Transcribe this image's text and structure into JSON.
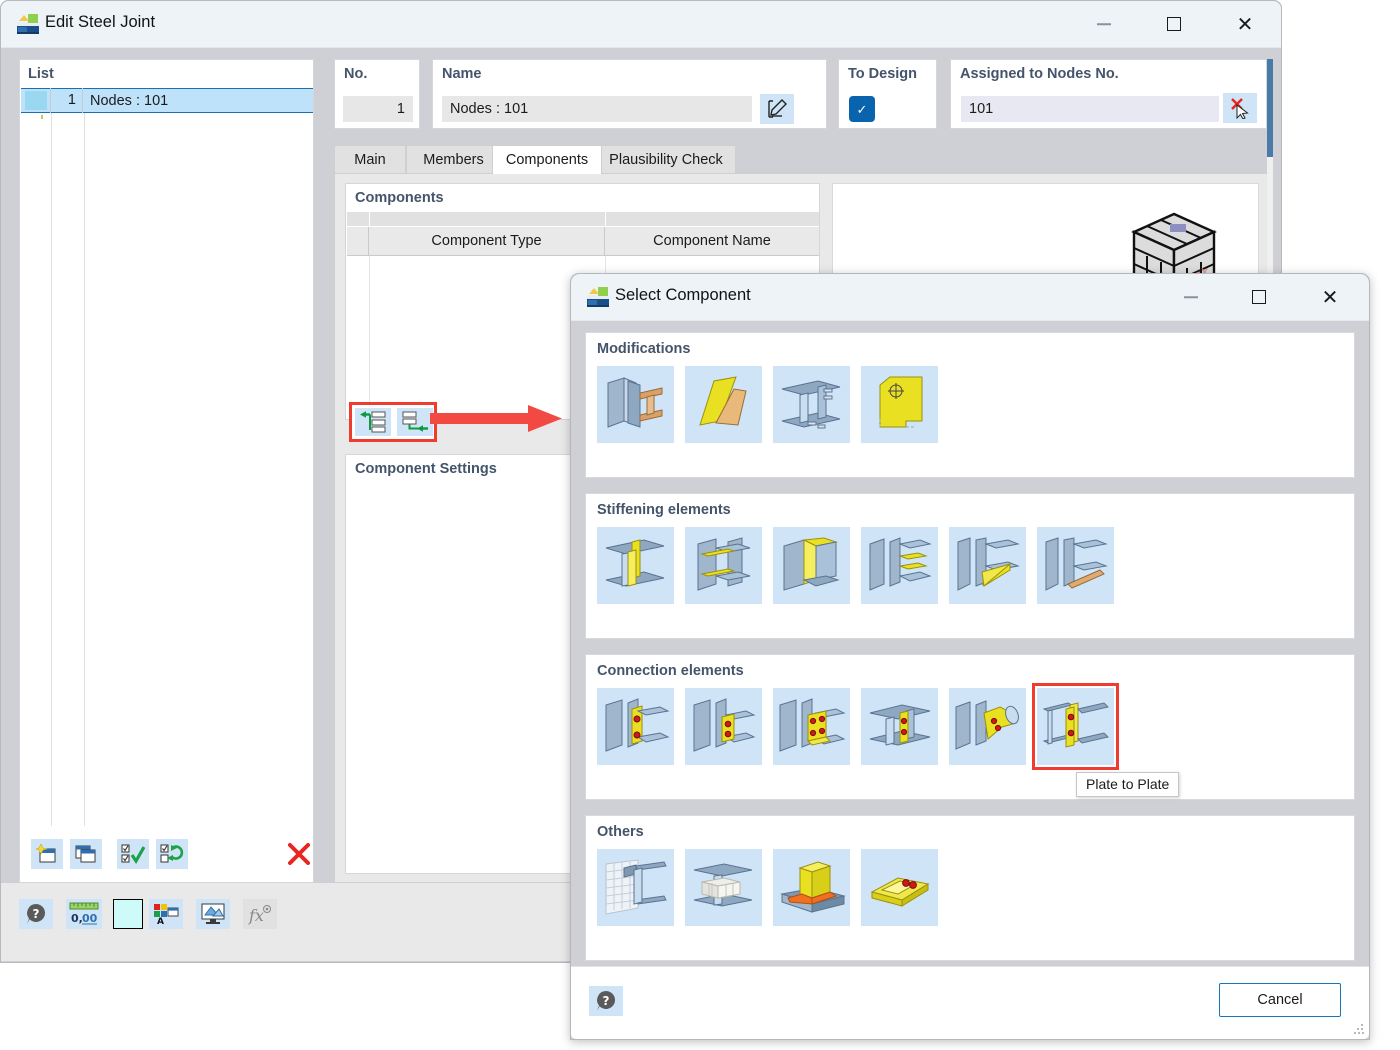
{
  "main_window": {
    "title": "Edit Steel Joint",
    "icon": "steel-joint-app-icon",
    "controls": {
      "minimize": "minimize-icon",
      "maximize": "maximize-icon",
      "close": "close-icon"
    }
  },
  "list_panel": {
    "header": "List",
    "rows": [
      {
        "color": "#9ad8f2",
        "no": "1",
        "name": "Nodes : 101"
      }
    ],
    "toolbar": [
      {
        "name": "new-item-button",
        "icon": "new-window-icon"
      },
      {
        "name": "copy-item-button",
        "icon": "copy-window-icon"
      },
      {
        "name": "check-all-button",
        "icon": "checklist-check-icon"
      },
      {
        "name": "toggle-selection-button",
        "icon": "checklist-refresh-icon"
      },
      {
        "name": "delete-item-button",
        "icon": "red-x-icon"
      }
    ]
  },
  "fields": {
    "no": {
      "label": "No.",
      "value": "1"
    },
    "name": {
      "label": "Name",
      "value": "Nodes : 101",
      "edit_button": "edit-pencil-icon"
    },
    "to_design": {
      "label": "To Design",
      "checked": true
    },
    "assigned_nodes": {
      "label": "Assigned to Nodes No.",
      "value": "101",
      "pick_button": "pick-node-cursor-icon"
    }
  },
  "tabs": [
    {
      "label": "Main",
      "active": false
    },
    {
      "label": "Members",
      "active": false
    },
    {
      "label": "Components",
      "active": true
    },
    {
      "label": "Plausibility Check",
      "active": false
    }
  ],
  "components_panel": {
    "title": "Components",
    "columns": [
      "",
      "Component Type",
      "Component Name"
    ],
    "rows": []
  },
  "mid_buttons": [
    {
      "name": "add-component-button",
      "icon": "insert-row-left-arrow-icon"
    },
    {
      "name": "insert-component-button",
      "icon": "insert-row-below-arrow-icon"
    }
  ],
  "settings_panel": {
    "title": "Component Settings"
  },
  "main_bottom_toolbar": [
    {
      "name": "help-button",
      "icon": "help-balloon-icon"
    },
    {
      "name": "units-button",
      "icon": "units-ruler-icon"
    },
    {
      "name": "color-button",
      "icon": "color-swatch-icon"
    },
    {
      "name": "display-properties-button",
      "icon": "display-properties-icon"
    },
    {
      "name": "rendering-button",
      "icon": "render-monitor-icon"
    },
    {
      "name": "formula-button",
      "icon": "fx-formula-icon"
    }
  ],
  "select_dialog": {
    "title": "Select Component",
    "icon": "steel-joint-app-icon",
    "controls": {
      "minimize": "minimize-icon",
      "maximize": "maximize-icon",
      "close": "close-icon"
    },
    "sections": [
      {
        "title": "Modifications",
        "items": [
          {
            "name": "component-tile-cut-member",
            "icon": "cut-member-icon"
          },
          {
            "name": "component-tile-plate-cut",
            "icon": "plate-cut-icon"
          },
          {
            "name": "component-tile-member-opening",
            "icon": "member-opening-icon"
          },
          {
            "name": "component-tile-plate-shape",
            "icon": "plate-shape-icon"
          }
        ]
      },
      {
        "title": "Stiffening elements",
        "items": [
          {
            "name": "component-tile-web-stiffener",
            "icon": "web-stiffener-icon"
          },
          {
            "name": "component-tile-flange-stiffener",
            "icon": "flange-stiffener-icon"
          },
          {
            "name": "component-tile-cap-plate",
            "icon": "cap-plate-icon"
          },
          {
            "name": "component-tile-multiple-stiffeners",
            "icon": "multiple-stiffeners-icon"
          },
          {
            "name": "component-tile-haunch-yellow",
            "icon": "haunch-icon"
          },
          {
            "name": "component-tile-haunch-brown",
            "icon": "haunch-alt-icon"
          }
        ]
      },
      {
        "title": "Connection elements",
        "items": [
          {
            "name": "component-tile-end-plate",
            "icon": "end-plate-icon"
          },
          {
            "name": "component-tile-fin-plate",
            "icon": "fin-plate-icon"
          },
          {
            "name": "component-tile-bolted-plate",
            "icon": "bolted-plate-icon"
          },
          {
            "name": "component-tile-gusset-plate",
            "icon": "gusset-plate-icon"
          },
          {
            "name": "component-tile-tube-connection",
            "icon": "tube-connection-icon"
          },
          {
            "name": "component-tile-plate-to-plate",
            "icon": "plate-to-plate-icon",
            "selected": true
          }
        ]
      },
      {
        "title": "Others",
        "items": [
          {
            "name": "component-tile-mesh-surface",
            "icon": "mesh-surface-icon"
          },
          {
            "name": "component-tile-solid-block",
            "icon": "solid-block-icon"
          },
          {
            "name": "component-tile-weld",
            "icon": "weld-icon"
          },
          {
            "name": "component-tile-bolt-assembly",
            "icon": "bolt-assembly-icon"
          }
        ]
      }
    ],
    "tooltip": "Plate to Plate",
    "footer": {
      "help_button": "help-balloon-icon",
      "cancel_label": "Cancel"
    }
  },
  "colors": {
    "accent_blue": "#0a64ad",
    "selection_blue": "#bfe2fb",
    "highlight_red": "#f03c2e",
    "title_text": "#44546a",
    "tile_bg": "#cfe5f7"
  }
}
